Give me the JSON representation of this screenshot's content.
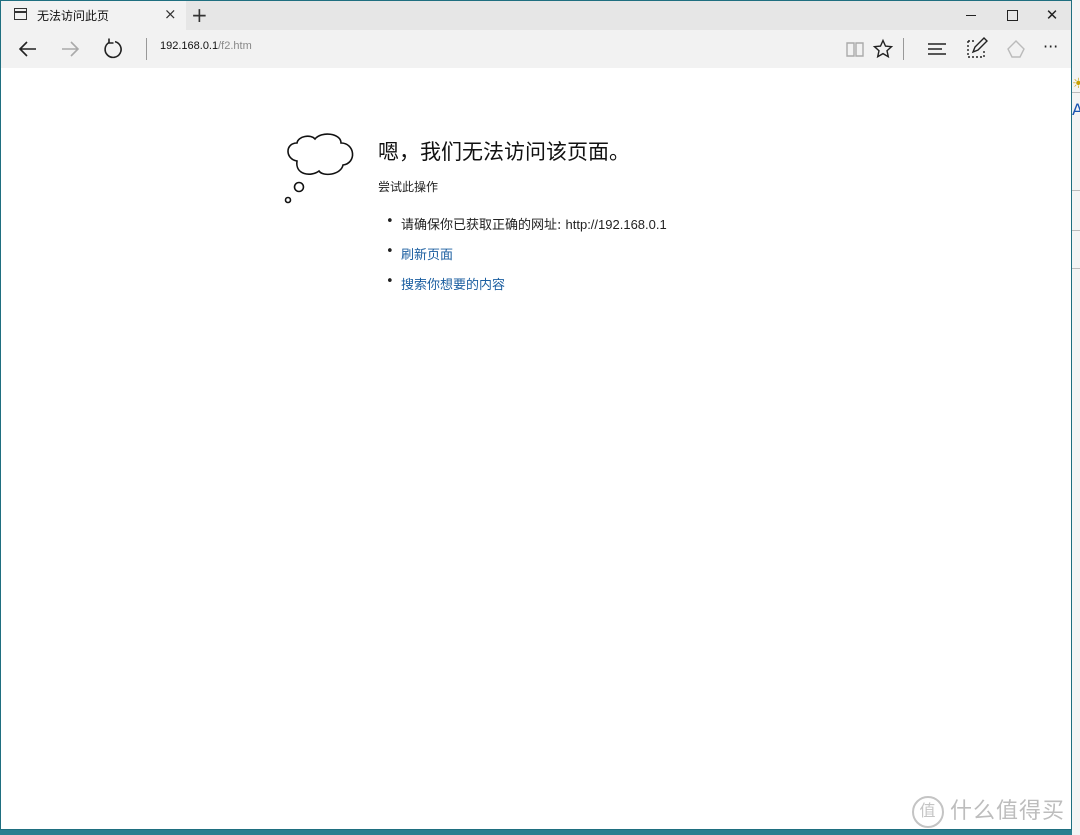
{
  "tab": {
    "title": "无法访问此页"
  },
  "address_bar": {
    "host": "192.168.0.1",
    "path": "/f2.htm"
  },
  "icons": {
    "page": "page-icon",
    "close_tab": "close-icon",
    "new_tab": "plus-icon",
    "minimize": "minimize-icon",
    "maximize": "maximize-icon",
    "close": "close-icon",
    "back": "arrow-left-icon",
    "forward": "arrow-right-icon",
    "refresh": "refresh-icon",
    "reading_view": "book-icon",
    "favorite": "star-icon",
    "hub": "hub-icon",
    "web_note": "pen-note-icon",
    "share": "share-icon",
    "more": "more-icon",
    "cloud": "thought-cloud-icon"
  },
  "window_controls": {
    "close_tab": "×",
    "new_tab": "+",
    "close": "✕",
    "more": "···"
  },
  "error": {
    "title": "嗯，我们无法访问该页面。",
    "subtitle": "尝试此操作",
    "items": [
      {
        "text": "请确保你已获取正确的网址: ",
        "url": "http://192.168.0.1"
      },
      {
        "text": "刷新页面"
      },
      {
        "text": "搜索你想要的内容"
      }
    ]
  },
  "watermark": {
    "logo": "值",
    "text": "什么值得买"
  },
  "colors": {
    "desktop": "#2a7f8f",
    "link": "#1b5ea0",
    "chrome": "#f2f2f2"
  }
}
